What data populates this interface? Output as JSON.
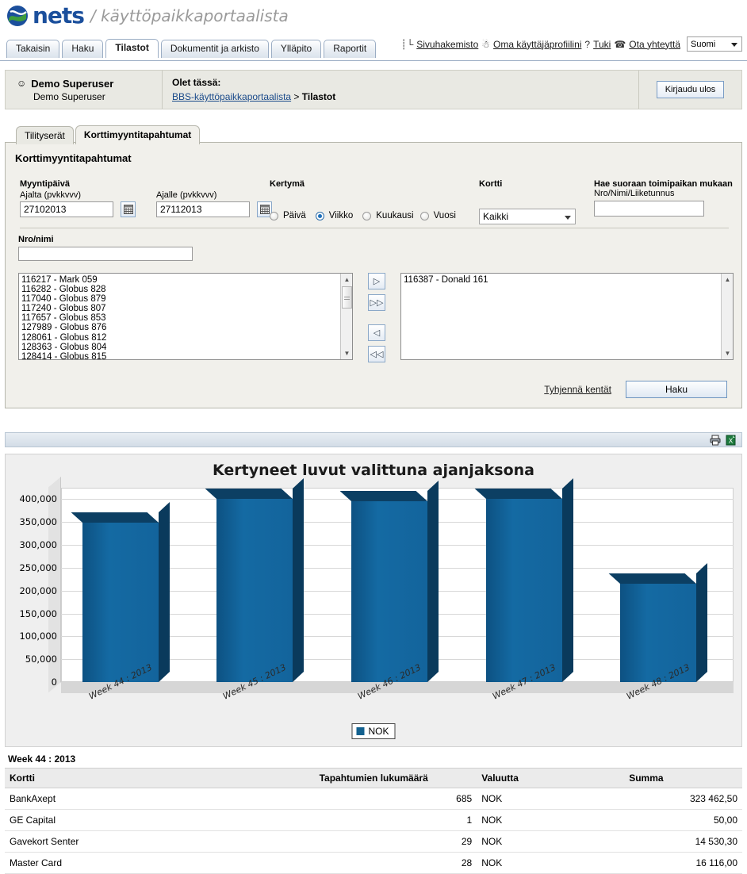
{
  "brand": {
    "name": "nets",
    "slash": "/",
    "tagline": "käyttöpaikkaportaalista",
    "blue": "#1b4f9c",
    "green": "#3d9c3d"
  },
  "topnav": {
    "tabs": [
      {
        "label": "Takaisin",
        "active": false
      },
      {
        "label": "Haku",
        "active": false
      },
      {
        "label": "Tilastot",
        "active": true
      },
      {
        "label": "Dokumentit ja arkisto",
        "active": false
      },
      {
        "label": "Ylläpito",
        "active": false
      },
      {
        "label": "Raportit",
        "active": false
      }
    ]
  },
  "headerlinks": {
    "sitemap": "Sivuhakemisto",
    "profile": "Oma käyttäjäprofiilini",
    "support": "Tuki",
    "contact": "Ota yhteyttä",
    "language": "Suomi"
  },
  "userbar": {
    "name": "Demo Superuser",
    "sub": "Demo Superuser",
    "here_label": "Olet tässä:",
    "crumb_link": "BBS-käyttöpaikkaportaalista",
    "crumb_sep": ">",
    "crumb_current": "Tilastot",
    "logout": "Kirjaudu ulos"
  },
  "subtabs": [
    {
      "label": "Tilityserät",
      "active": false
    },
    {
      "label": "Korttimyyntitapahtumat",
      "active": true
    }
  ],
  "panel": {
    "title": "Korttimyyntitapahtumat",
    "sale_day_label": "Myyntipäivä",
    "from_label": "Ajalta (pvkkvvv)",
    "from_value": "27102013",
    "to_label": "Ajalle (pvkkvvv)",
    "to_value": "27112013",
    "accrual_label": "Kertymä",
    "accrual_options": [
      {
        "label": "Päivä",
        "selected": false
      },
      {
        "label": "Viikko",
        "selected": true
      },
      {
        "label": "Kuukausi",
        "selected": false
      },
      {
        "label": "Vuosi",
        "selected": false
      }
    ],
    "card_label": "Kortti",
    "card_value": "Kaikki",
    "direct_label": "Hae suoraan toimipaikan mukaan",
    "direct_sublabel": "Nro/Nimi/Liiketunnus",
    "direct_value": "",
    "nroname_label": "Nro/nimi",
    "nroname_value": "",
    "available_items": [
      "116217 - Mark 059",
      "116282 - Globus 828",
      "117040 - Globus 879",
      "117240 - Globus 807",
      "117657 - Globus 853",
      "127989 - Globus 876",
      "128061 - Globus 812",
      "128363 - Globus 804",
      "128414 - Globus 815"
    ],
    "selected_items": [
      "116387 - Donald 161"
    ],
    "transfer_buttons": [
      "move-right",
      "move-all-right",
      "move-left",
      "move-all-left"
    ],
    "clear_link": "Tyhjennä kentät",
    "search_button": "Haku"
  },
  "toolstrip": {
    "print": "print-icon",
    "excel": "excel-export-icon"
  },
  "chart_data": {
    "type": "bar",
    "title": "Kertyneet luvut valittuna ajanjaksona",
    "categories": [
      "Week 44 : 2013",
      "Week 45 : 2013",
      "Week 46 : 2013",
      "Week 47 : 2013",
      "Week 48 : 2013"
    ],
    "values": [
      348000,
      400000,
      395000,
      400000,
      215000
    ],
    "series": [
      {
        "name": "NOK",
        "values": [
          348000,
          400000,
          395000,
          400000,
          215000
        ]
      }
    ],
    "legend": [
      "NOK"
    ],
    "legend_position": "bottom",
    "xlabel": "",
    "ylabel": "",
    "ylim": [
      0,
      425000
    ],
    "yticks": [
      0,
      50000,
      100000,
      150000,
      200000,
      250000,
      300000,
      350000,
      400000
    ],
    "ytick_labels": [
      "0",
      "50,000",
      "100,000",
      "150,000",
      "200,000",
      "250,000",
      "300,000",
      "350,000",
      "400,000"
    ],
    "grid": true,
    "bar_color": "#13618f"
  },
  "results": {
    "caption": "Week 44 : 2013",
    "columns": [
      "Kortti",
      "Tapahtumien lukumäärä",
      "Valuutta",
      "Summa"
    ],
    "rows": [
      {
        "kortti": "BankAxept",
        "count": "685",
        "currency": "NOK",
        "sum": "323 462,50"
      },
      {
        "kortti": "GE Capital",
        "count": "1",
        "currency": "NOK",
        "sum": "50,00"
      },
      {
        "kortti": "Gavekort Senter",
        "count": "29",
        "currency": "NOK",
        "sum": "14 530,30"
      },
      {
        "kortti": "Master Card",
        "count": "28",
        "currency": "NOK",
        "sum": "16 116,00"
      }
    ]
  }
}
